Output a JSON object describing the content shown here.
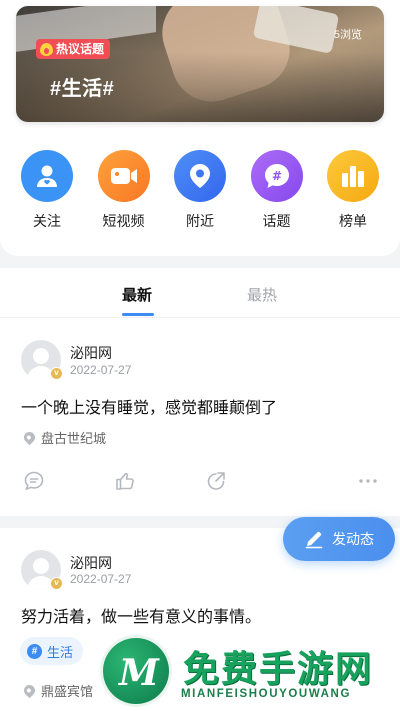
{
  "banner": {
    "badge": "热议话题",
    "topic": "#生活#",
    "views": "5浏览"
  },
  "nav": [
    {
      "label": "关注",
      "icon": "follow-user-icon",
      "color": "#3b93f5"
    },
    {
      "label": "短视频",
      "icon": "video-camera-icon",
      "color": "#fb8a2c"
    },
    {
      "label": "附近",
      "icon": "location-pin-icon",
      "color": "#4279f2"
    },
    {
      "label": "话题",
      "icon": "topic-hashtag-icon",
      "color": "#9b5cf2"
    },
    {
      "label": "榜单",
      "icon": "ranking-chart-icon",
      "color": "#f9bb1c"
    }
  ],
  "tabs": [
    {
      "label": "最新",
      "active": true
    },
    {
      "label": "最热",
      "active": false
    }
  ],
  "posts": [
    {
      "author": "泌阳网",
      "date": "2022-07-27",
      "content": "一个晚上没有睡觉，感觉都睡颠倒了",
      "location": "盘古世纪城"
    },
    {
      "author": "泌阳网",
      "date": "2022-07-27",
      "content": "努力活着，做一些有意义的事情。",
      "topic": "生活",
      "location": "鼎盛宾馆"
    }
  ],
  "fab": {
    "label": "发动态"
  },
  "watermark": {
    "title": "免费手游网",
    "subtitle": "MIANFEISHOUYOUWANG"
  }
}
